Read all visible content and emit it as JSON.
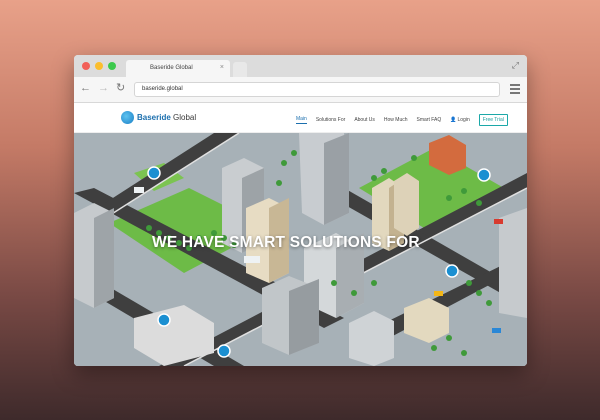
{
  "browser": {
    "tab_title": "Baseride Global",
    "tab_close": "×",
    "url": "baseride.global"
  },
  "site": {
    "logo_text_1": "Baseride",
    "logo_text_2": "Global",
    "menu": [
      {
        "label": "Main"
      },
      {
        "label": "Solutions For"
      },
      {
        "label": "About Us"
      },
      {
        "label": "How Much"
      },
      {
        "label": "Smart FAQ"
      }
    ],
    "login_label": "Login",
    "free_trial_label": "Free Trial",
    "headline": "WE HAVE SMART SOLUTIONS FOR"
  },
  "icons": [
    "back-arrow-icon",
    "forward-arrow-icon",
    "reload-icon",
    "menu-icon",
    "expand-icon",
    "user-icon"
  ],
  "colors": {
    "accent": "#1b6fae",
    "trial": "#1ba8a8",
    "grass": "#6dbb47",
    "road": "#3f3f3f"
  }
}
